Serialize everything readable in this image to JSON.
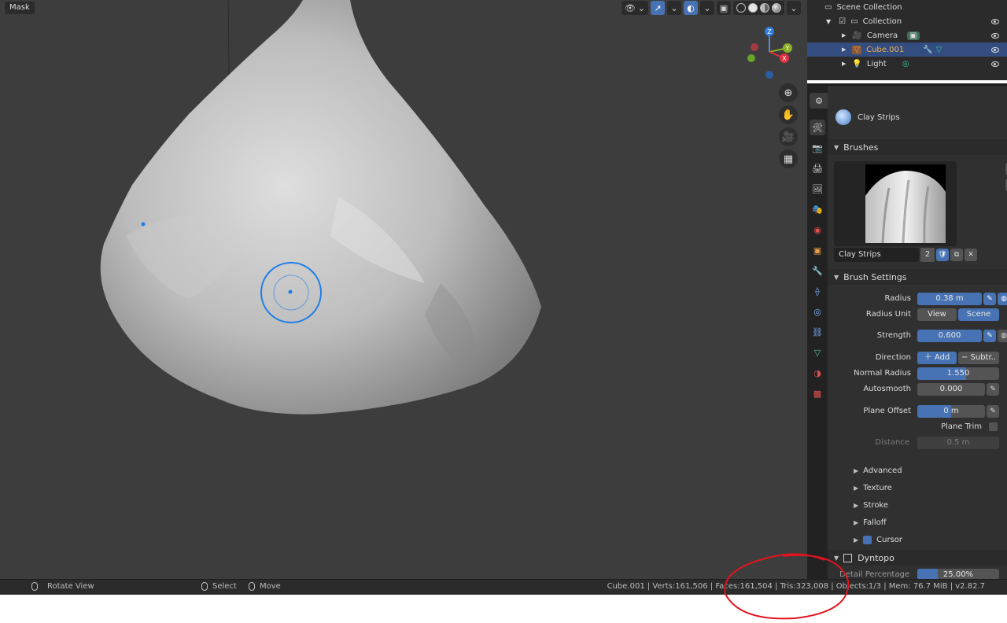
{
  "viewport": {
    "mode_label": "Mask"
  },
  "outliner": {
    "root": "Scene Collection",
    "collection": "Collection",
    "items": [
      "Camera",
      "Cube.001",
      "Light"
    ]
  },
  "properties": {
    "tool_name": "Clay Strips",
    "brushes_header": "Brushes",
    "brush_name": "Clay Strips",
    "brush_users": "2",
    "brush_settings_header": "Brush Settings",
    "radius": {
      "label": "Radius",
      "value": "0.38 m",
      "fill": 1.0
    },
    "radius_unit": {
      "label": "Radius Unit",
      "options": [
        "View",
        "Scene"
      ],
      "selected": "Scene"
    },
    "strength": {
      "label": "Strength",
      "value": "0.600",
      "fill": 1.0
    },
    "direction": {
      "label": "Direction",
      "options": [
        "Add",
        "Subtr.."
      ],
      "selected": "Add"
    },
    "normal_radius": {
      "label": "Normal Radius",
      "value": "1.550",
      "fill": 0.6
    },
    "autosmooth": {
      "label": "Autosmooth",
      "value": "0.000",
      "fill": 0.0
    },
    "plane_offset": {
      "label": "Plane Offset",
      "value": "0 m",
      "fill": 0.5
    },
    "plane_trim": {
      "label": "Plane Trim",
      "checked": false
    },
    "distance": {
      "label": "Distance",
      "value": "0.5 m"
    },
    "subpanels": [
      "Advanced",
      "Texture",
      "Stroke",
      "Falloff",
      "Cursor"
    ],
    "cursor_checked": true,
    "dyntopo_header": "Dyntopo",
    "detail_label": "Detail Percentage",
    "detail_value": "25.00%"
  },
  "statusbar": {
    "rotate": "Rotate View",
    "select": "Select",
    "move": "Move",
    "stats": "Cube.001 | Verts:161,506 | Faces:161,504 | Tris:323,008 | Objects:1/3 | Mem: 76.7 MiB | v2.82.7"
  },
  "colors": {
    "accent": "#4772b3",
    "selected_row": "#334d80",
    "annotation": "#e0141e",
    "brush_cursor": "#1e7ee8"
  }
}
